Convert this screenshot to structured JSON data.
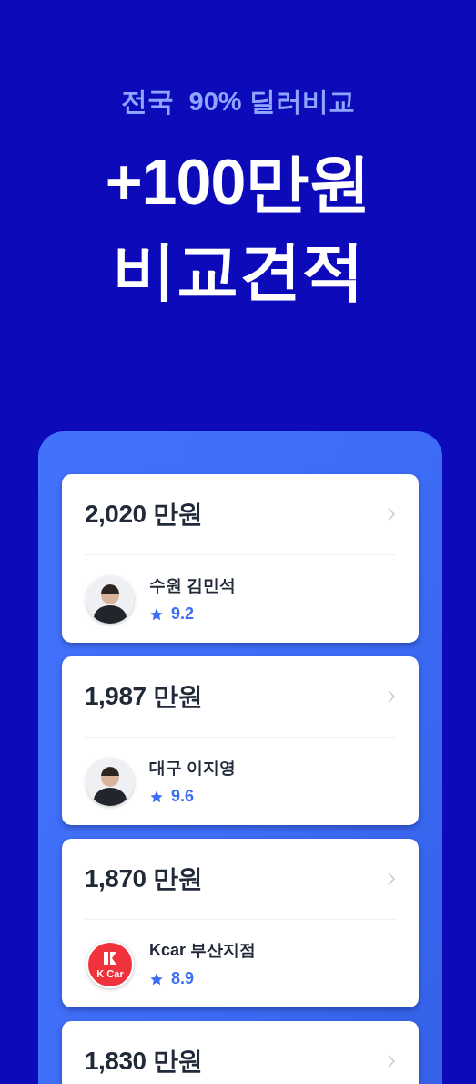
{
  "header": {
    "subtitle": "전국  90% 딜러비교",
    "headline": [
      "+100만원",
      "비교견적"
    ]
  },
  "quotes": [
    {
      "price": "2,020 만원",
      "dealer": {
        "kind": "person",
        "name": "수원 김민석",
        "rating": "9.2"
      }
    },
    {
      "price": "1,987 만원",
      "dealer": {
        "kind": "person",
        "name": "대구 이지영",
        "rating": "9.6"
      }
    },
    {
      "price": "1,870 만원",
      "dealer": {
        "kind": "logo",
        "logo_text": "K Car",
        "name": "Kcar 부산지점",
        "rating": "8.9"
      }
    },
    {
      "price": "1,830 만원"
    }
  ]
}
